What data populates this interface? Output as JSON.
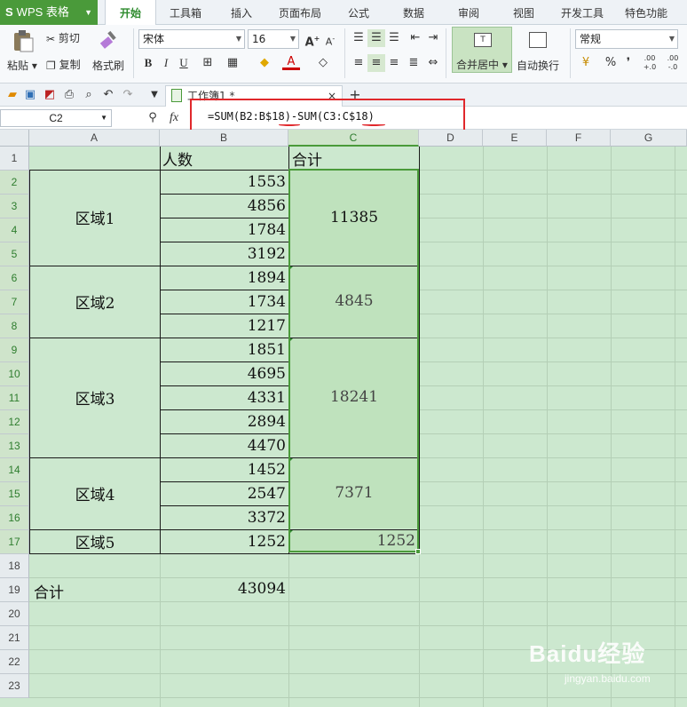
{
  "app": {
    "logo": "WPS 表格",
    "accent": "#4a9a3a"
  },
  "menu_tabs": [
    "开始",
    "工具箱",
    "插入",
    "页面布局",
    "公式",
    "数据",
    "审阅",
    "视图",
    "开发工具",
    "特色功能"
  ],
  "active_tab": "开始",
  "ribbon": {
    "paste": "粘贴",
    "cut": "剪切",
    "copy": "复制",
    "format_painter": "格式刷",
    "font_name": "宋体",
    "font_size": "16",
    "merge_center": "合并居中",
    "wrap_text": "自动换行",
    "number_format": "常规",
    "percent": "%",
    "comma": "❜",
    "inc_decimal": ".00 +.0",
    "dec_decimal": ".00 -.0"
  },
  "doc_tab": {
    "title": "工作簿1 *",
    "close": "×",
    "new": "+"
  },
  "formula_bar": {
    "name_box": "C2",
    "fx": "fx",
    "formula": "=SUM(B2:B$18)-SUM(C3:C$18)"
  },
  "columns": [
    "A",
    "B",
    "C",
    "D",
    "E",
    "F",
    "G"
  ],
  "rows": [
    "1",
    "2",
    "3",
    "4",
    "5",
    "6",
    "7",
    "8",
    "9",
    "10",
    "11",
    "12",
    "13",
    "14",
    "15",
    "16",
    "17",
    "18",
    "19",
    "20",
    "21",
    "22",
    "23"
  ],
  "header_row": {
    "b": "人数",
    "c": "合计"
  },
  "regions": [
    {
      "label": "区域1",
      "total": "11385"
    },
    {
      "label": "区域2",
      "total": "4845"
    },
    {
      "label": "区域3",
      "total": "18241"
    },
    {
      "label": "区域4",
      "total": "7371"
    },
    {
      "label": "区域5",
      "total": "1252"
    }
  ],
  "values": [
    "1553",
    "4856",
    "1784",
    "3192",
    "1894",
    "1734",
    "1217",
    "1851",
    "4695",
    "4331",
    "2894",
    "4470",
    "1452",
    "2547",
    "3372",
    "1252"
  ],
  "summary": {
    "label": "合计",
    "value": "43094"
  },
  "watermark": {
    "brand": "Baidu经验",
    "url": "jingyan.baidu.com"
  }
}
